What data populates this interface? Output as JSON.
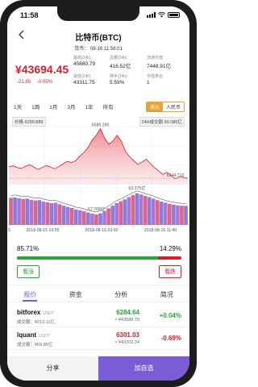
{
  "status": {
    "time": "11:58"
  },
  "nav": {
    "title": "比特币(BTC)",
    "subtitle": "货币： 08-16 11:58:01"
  },
  "price": {
    "value": "¥43694.45",
    "change_abs": "-21.85",
    "change_pct": "-0.05%"
  },
  "stats": [
    {
      "label": "最高(24h)",
      "value": "45680.79"
    },
    {
      "label": "总额(24h)",
      "value": "416.52亿"
    },
    {
      "label": "流通市值",
      "value": "7448.91亿"
    },
    {
      "label": "最低(24h)",
      "value": "43311.75"
    },
    {
      "label": "换手(24h)",
      "value": "5.59%"
    },
    {
      "label": "市值排名",
      "value": "1"
    }
  ],
  "periods": [
    "1天",
    "1周",
    "1月",
    "3月",
    "1年",
    "所有"
  ],
  "currency": {
    "on": "美元",
    "off": "人民币"
  },
  "chart": {
    "price_chip": "价格",
    "price_chip_value": "6299.889",
    "vol_chip": "24H成交额",
    "vol_chip_value": "60.080亿",
    "high_label": "6586.290",
    "last_label": "6244.710",
    "vol_high_label": "63.375亿",
    "vol_low_label": "57.768亿",
    "x_labels": [
      "2018-08-15 19:55",
      "2018-08-16 03:50",
      "2018-08-16 11:40"
    ],
    "x_prefix": "0"
  },
  "chart_data": [
    {
      "type": "area",
      "title": "",
      "series": [
        {
          "name": "价格",
          "values": [
            6322,
            6330,
            6318,
            6312,
            6326,
            6338,
            6320,
            6305,
            6318,
            6332,
            6321,
            6310,
            6324,
            6342,
            6360,
            6352,
            6364,
            6396,
            6420,
            6455,
            6508,
            6540,
            6586,
            6520,
            6478,
            6500,
            6540,
            6500,
            6430,
            6392,
            6365,
            6340,
            6356,
            6375,
            6345,
            6316,
            6294,
            6270,
            6285,
            6262,
            6240,
            6256,
            6250,
            6244
          ]
        }
      ]
    },
    {
      "type": "bar",
      "title": "",
      "series": [
        {
          "name": "24H成交额",
          "values": [
            62.2,
            62.3,
            62.1,
            61.9,
            62.0,
            61.7,
            61.5,
            61.6,
            61.2,
            61.0,
            60.8,
            60.9,
            60.5,
            60.1,
            59.8,
            59.5,
            59.1,
            58.9,
            58.6,
            58.3,
            58.0,
            57.8,
            58.1,
            58.7,
            59.4,
            60.1,
            60.8,
            61.3,
            61.8,
            62.4,
            62.9,
            63.4,
            63.1,
            62.7,
            62.4,
            62.0,
            61.6,
            61.2,
            60.9,
            60.6,
            60.4,
            60.2,
            60.1,
            60.08
          ]
        }
      ]
    }
  ],
  "ratio": {
    "left": "85.71%",
    "right": "14.29%",
    "bull_fraction": 0.8571,
    "up_label": "看涨",
    "down_label": "看跌"
  },
  "bottom_tabs": [
    "报价",
    "资金",
    "分析",
    "简况"
  ],
  "markets": [
    {
      "exchange": "bitforex",
      "pair": "USDT",
      "volume": "成交额：¥213.11亿",
      "price": "6284.64",
      "cny": "≈ ¥43588.70",
      "pct": "+0.04%",
      "dir": "up"
    },
    {
      "exchange": "lquant",
      "pair": "USDT",
      "volume": "成交额：¥69.85亿",
      "price": "6301.03",
      "cny": "≈ ¥43702.34",
      "pct": "-0.69%",
      "dir": "down"
    }
  ],
  "footer": {
    "share": "分享",
    "add": "加自选"
  },
  "colors": {
    "accent": "#7c5cd6",
    "down": "#d81e2c",
    "up": "#2aa63a"
  }
}
